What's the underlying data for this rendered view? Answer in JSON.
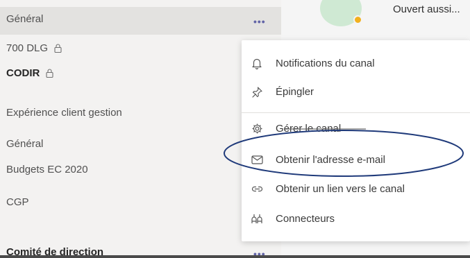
{
  "sidebar": {
    "active_channel": "Général",
    "channels": [
      {
        "label": "700 DLG",
        "locked": true
      },
      {
        "label": "CODIR",
        "locked": true
      },
      {
        "label": "Expérience client gestion"
      },
      {
        "label": "Général"
      },
      {
        "label": "Budgets EC 2020"
      },
      {
        "label": "CGP"
      },
      {
        "label": "Comité de direction"
      }
    ],
    "more_label": "•••"
  },
  "header": {
    "open_text": "Ouvert aussi..."
  },
  "context_menu": {
    "items": [
      {
        "label": "Notifications du canal",
        "icon": "bell-icon"
      },
      {
        "label": "Épingler",
        "icon": "pin-icon"
      },
      {
        "label": "Gérer le canal",
        "icon": "gear-icon"
      },
      {
        "label": "Obtenir l'adresse e-mail",
        "icon": "mail-icon",
        "highlighted": true
      },
      {
        "label": "Obtenir un lien vers le canal",
        "icon": "link-icon"
      },
      {
        "label": "Connecteurs",
        "icon": "connectors-icon"
      }
    ]
  },
  "colors": {
    "accent": "#6264a7",
    "highlight_ellipse": "#1f3a7a",
    "menu_bg": "#ffffff"
  }
}
